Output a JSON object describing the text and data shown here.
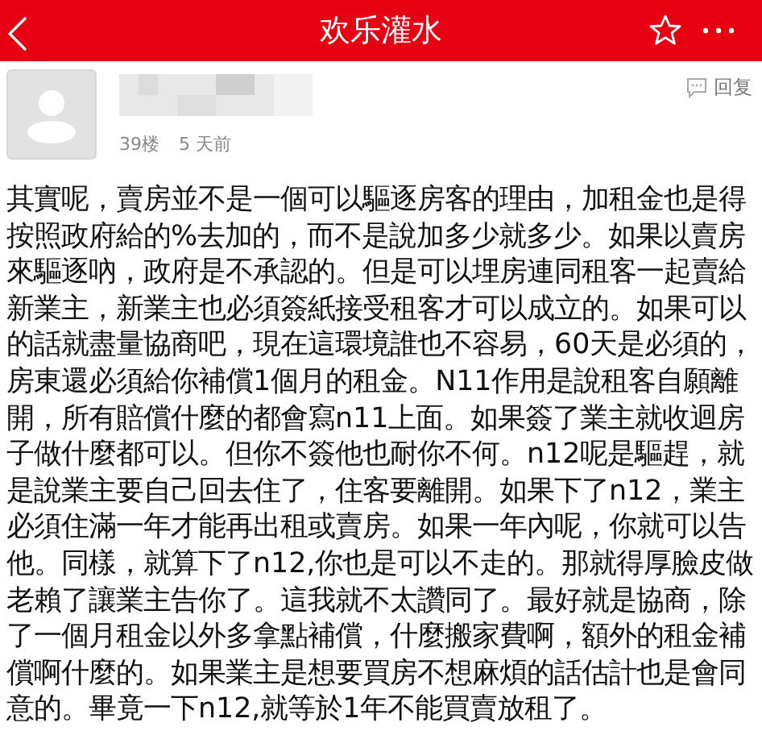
{
  "header": {
    "title": "欢乐灌水"
  },
  "post": {
    "floor": "39楼",
    "time": "5 天前",
    "reply_label": "回复",
    "body": "其實呢，賣房並不是一個可以驅逐房客的理由，加租金也是得按照政府給的%去加的，而不是說加多少就多少。如果以賣房來驅逐吶，政府是不承認的。但是可以埋房連同租客一起賣給新業主，新業主也必須簽紙接受租客才可以成立的。如果可以的話就盡量協商吧，現在這環境誰也不容易，60天是必須的，房東還必須給你補償1個月的租金。N11作用是說租客自願離開，所有賠償什麼的都會寫n11上面。如果簽了業主就收迴房子做什麼都可以。但你不簽他也耐你不何。n12呢是驅趕，就是說業主要自己回去住了，住客要離開。如果下了n12，業主必須住滿一年才能再出租或賣房。如果一年內呢，你就可以告他。同樣，就算下了n12,你也是可以不走的。那就得厚臉皮做老賴了讓業主告你了。這我就不太讚同了。最好就是協商，除了一個月租金以外多拿點補償，什麼搬家費啊，額外的租金補償啊什麼的。如果業主是想要買房不想麻煩的話估計也是會同意的。畢竟一下n12,就等於1年不能買賣放租了。"
  }
}
